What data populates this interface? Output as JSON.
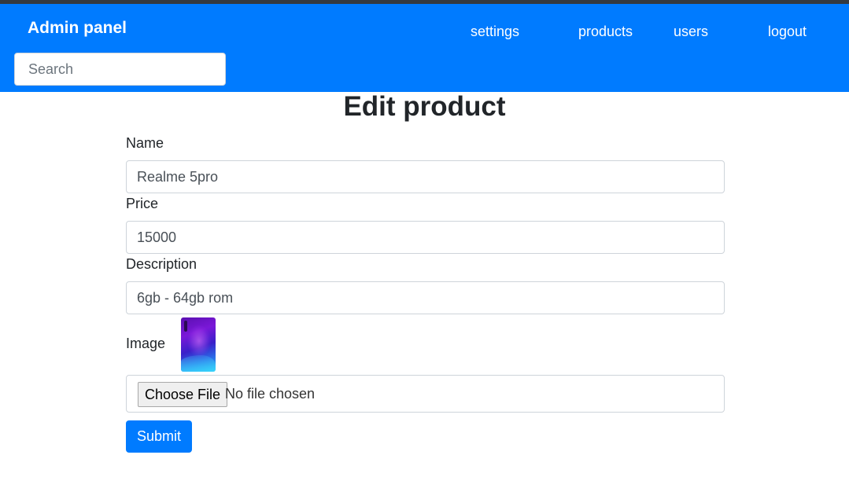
{
  "navbar": {
    "brand": "Admin panel",
    "links": [
      "settings",
      "products",
      "users",
      "logout"
    ],
    "search_placeholder": "Search",
    "color": "#007bff"
  },
  "page": {
    "title": "Edit product"
  },
  "form": {
    "name_label": "Name",
    "name_value": "Realme 5pro",
    "price_label": "Price",
    "price_value": "15000",
    "description_label": "Description",
    "description_value": "6gb - 64gb rom",
    "image_label": "Image",
    "file_button": "Choose File",
    "file_status": "No file chosen",
    "submit_label": "Submit"
  }
}
